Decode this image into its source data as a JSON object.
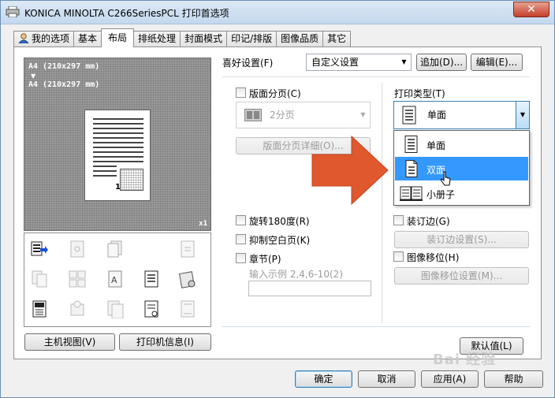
{
  "window": {
    "title": "KONICA MINOLTA C266SeriesPCL 打印首选项",
    "close_glyph": "✕"
  },
  "tabs": [
    {
      "label": "我的选项"
    },
    {
      "label": "基本"
    },
    {
      "label": "布局"
    },
    {
      "label": "排纸处理"
    },
    {
      "label": "封面模式"
    },
    {
      "label": "印记/排版"
    },
    {
      "label": "图像品质"
    },
    {
      "label": "其它"
    }
  ],
  "preview": {
    "line1": "A4 (210x297 mm)",
    "arrow": "▼",
    "line2": "A4 (210x297 mm)",
    "page_number": "1",
    "scale": "x1"
  },
  "left_buttons": {
    "main_view": "主机视图(V)",
    "printer_info": "打印机信息(I)"
  },
  "favorites": {
    "label": "喜好设置(F)",
    "value": "自定义设置",
    "add": "追加(D)...",
    "edit": "编辑(E)..."
  },
  "layout": {
    "combination_label": "版面分页(C)",
    "combination_value": "2分页",
    "combination_detail": "版面分页详细(O)...",
    "rotate": "旋转180度(R)",
    "skip_blank": "抑制空白页(K)",
    "chapter": "章节(P)",
    "chapter_example": "输入示例 2,4,6-10(2)"
  },
  "print_type": {
    "label": "打印类型(T)",
    "value": "单面",
    "options": [
      {
        "label": "单面"
      },
      {
        "label": "双面"
      },
      {
        "label": "小册子"
      }
    ]
  },
  "binding": {
    "margin": "装订边(G)",
    "margin_settings": "装订边设置(S)...",
    "shift": "图像移位(H)",
    "shift_settings": "图像移位设置(M)..."
  },
  "defaults": "默认值(L)",
  "footer": {
    "ok": "确定",
    "cancel": "取消",
    "apply": "应用(A)",
    "help": "帮助"
  },
  "watermark": "Bai 经验"
}
